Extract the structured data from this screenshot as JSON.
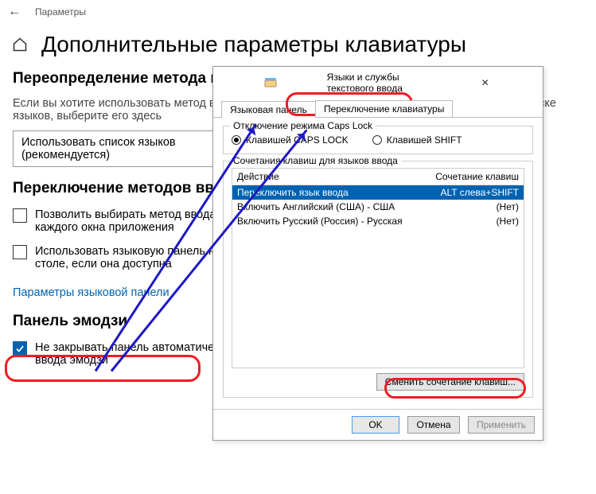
{
  "topbar": {
    "label": "Параметры"
  },
  "page": {
    "title": "Дополнительные параметры клавиатуры"
  },
  "sec1": {
    "heading": "Переопределение метода ввода по умолчанию",
    "desc": "Если вы хотите использовать метод ввода, отличный от указанного на первом месте в вашем списке языков, выберите его здесь",
    "dropdown": "Использовать список языков (рекомендуется)"
  },
  "sec2": {
    "heading": "Переключение методов ввода",
    "chk1": "Позволить выбирать метод ввода для каждого окна приложения",
    "chk2": "Использовать языковую панель на рабочем столе, если она доступна",
    "link": "Параметры языковой панели"
  },
  "sec3": {
    "heading": "Панель эмодзи",
    "chk": "Не закрывать панель автоматически после ввода эмодзи"
  },
  "dlg": {
    "title": "Языки и службы текстового ввода",
    "tabs": {
      "lang": "Языковая панель",
      "switch": "Переключение клавиатуры"
    },
    "caps": {
      "legend": "Отключение режима Caps Lock",
      "r1": "Клавишей CAPS LOCK",
      "r2": "Клавишей SHIFT"
    },
    "combo": {
      "legend": "Сочетания клавиш для языков ввода",
      "hAction": "Действие",
      "hKeys": "Сочетание клавиш",
      "rows": [
        {
          "a": "Переключить язык ввода",
          "k": "ALT слева+SHIFT"
        },
        {
          "a": "Включить Английский (США) - США",
          "k": "(Нет)"
        },
        {
          "a": "Включить Русский (Россия) - Русская",
          "k": "(Нет)"
        }
      ],
      "change": "Сменить сочетание клавиш..."
    },
    "foot": {
      "ok": "OK",
      "cancel": "Отмена",
      "apply": "Применить"
    }
  }
}
